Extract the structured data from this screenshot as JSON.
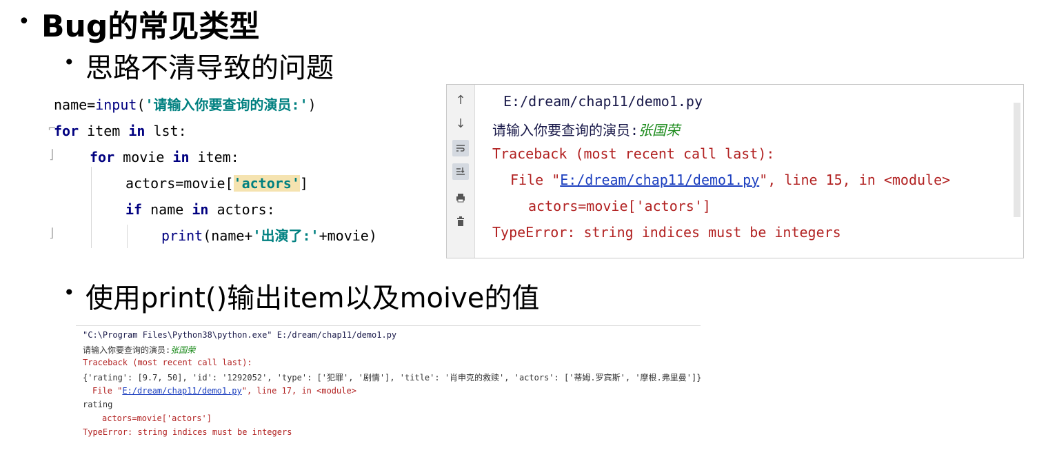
{
  "heading": {
    "bullet": "•",
    "title": "Bug的常见类型"
  },
  "subheading1": {
    "bullet": "•",
    "text": "思路不清导致的问题"
  },
  "subheading2": {
    "bullet": "•",
    "text": "使用print()输出item以及moive的值"
  },
  "code": {
    "line1": {
      "a": "name=",
      "fn": "input",
      "b": "(",
      "str": "'请输入你要查询的演员:'",
      "c": ")"
    },
    "line2": {
      "kw1": "for",
      "a": " item ",
      "kw2": "in",
      "b": " lst:"
    },
    "line3": {
      "kw1": "for",
      "a": " movie ",
      "kw2": "in",
      "b": " item:"
    },
    "line4": {
      "a": "actors=movie[",
      "str": "'actors'",
      "b": "]"
    },
    "line5": {
      "kw1": "if",
      "a": " name ",
      "kw2": "in",
      "b": " actors:"
    },
    "line6": {
      "fn": "print",
      "a": "(name+",
      "str": "'出演了:'",
      "b": "+movie)"
    }
  },
  "console": {
    "toolbar_icons": [
      "arrow-up-icon",
      "arrow-down-icon",
      "soft-wrap-icon",
      "scroll-to-end-icon",
      "print-icon",
      "trash-icon"
    ],
    "path_line": "E:/dream/chap11/demo1.py",
    "prompt": "请输入你要查询的演员:",
    "input_value": "张国荣",
    "traceback": "Traceback (most recent call last):",
    "file_prefix": "File \"",
    "file_link": "E:/dream/chap11/demo1.py",
    "file_suffix": "\", line 15, in <module>",
    "code_line": "actors=movie['actors']",
    "error": "TypeError: string indices must be integers"
  },
  "screenshot": {
    "cmd_line": "\"C:\\Program Files\\Python38\\python.exe\" E:/dream/chap11/demo1.py",
    "prompt": "请输入你要查询的演员:",
    "input_value": "张国荣",
    "traceback": "Traceback (most recent call last):",
    "dict_line": "{'rating': [9.7, 50], 'id': '1292052', 'type': ['犯罪', '剧情'], 'title': '肖申克的救赎', 'actors': ['蒂姆.罗宾斯', '摩根.弗里曼']}",
    "file_prefix": "File \"",
    "file_link": "E:/dream/chap11/demo1.py",
    "file_suffix": "\", line 17, in <module>",
    "rating": "rating",
    "code_line": "actors=movie['actors']",
    "error": "TypeError: string indices must be integers"
  },
  "colors": {
    "keyword": "#000080",
    "string": "#008080",
    "error_red": "#b22222",
    "link": "#1c3fbf",
    "input_green": "#1a8a1a"
  }
}
